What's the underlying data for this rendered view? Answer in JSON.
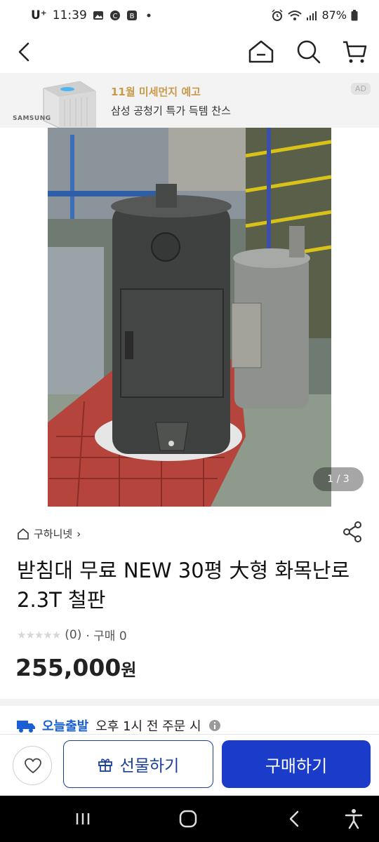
{
  "status_bar": {
    "carrier": "U⁺",
    "time": "11:39",
    "battery": "87%"
  },
  "nav": {
    "icons": [
      "back-icon",
      "home-icon",
      "search-icon",
      "cart-icon"
    ]
  },
  "ad": {
    "brand": "SAMSUNG",
    "headline": "11월 미세먼지 예고",
    "subtext": "삼성 공청기 특가 득템 찬스",
    "badge": "AD"
  },
  "image_counter": "1 / 3",
  "shop": {
    "name": "구하니넷",
    "chevron": "›"
  },
  "product": {
    "title": "받침대 무료 NEW 30평 大형 화목난로 2.3T 철판",
    "rating_stars": "★★★★★",
    "review_count": "(0)",
    "purchase_count": "· 구매 0",
    "price": "255,000",
    "currency": "원"
  },
  "delivery": {
    "label": "오늘출발",
    "text": "오후 1시 전 주문 시"
  },
  "buttons": {
    "gift": "선물하기",
    "buy": "구매하기"
  },
  "colors": {
    "accent": "#1a3cc8",
    "outline": "#1a3f9a",
    "ad_headline": "#c89a4a"
  }
}
